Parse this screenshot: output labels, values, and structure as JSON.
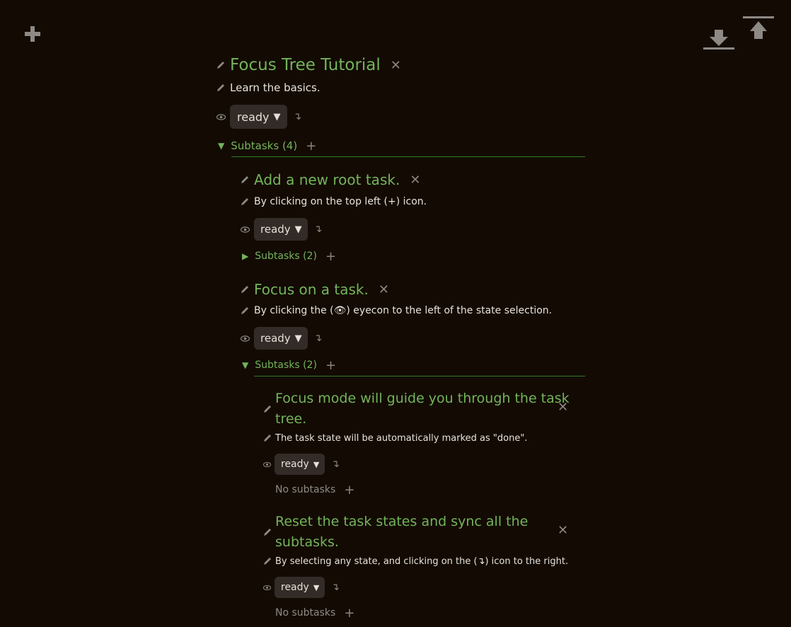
{
  "toolbar": {
    "add_root_icon": "plus-icon",
    "download_icon": "download-icon",
    "upload_icon": "upload-icon"
  },
  "root": {
    "title": "Focus Tree Tutorial",
    "description": "Learn the basics.",
    "state": "ready",
    "subtasks_label": "Subtasks (4)"
  },
  "tasks": [
    {
      "title": "Add a new root task.",
      "description": "By clicking on the top left (+) icon.",
      "state": "ready",
      "subtasks_label": "Subtasks (2)"
    },
    {
      "title": "Focus on a task.",
      "description": "By clicking the (👁) eyecon to the left of the state selection.",
      "state": "ready",
      "subtasks_label": "Subtasks (2)",
      "children": [
        {
          "title_line1": "Focus mode will guide you through the task",
          "title_line2": "tree.",
          "description": "The task state will be automatically marked as \"done\".",
          "state": "ready",
          "subtasks_label": "No subtasks"
        },
        {
          "title_line1": "Reset the task states and sync all the",
          "title_line2": "subtasks.",
          "description": "By selecting any state, and clicking on the (↴) icon to the right.",
          "state": "ready",
          "subtasks_label": "No subtasks"
        }
      ]
    }
  ],
  "colors": {
    "background": "#130b03",
    "accent_green": "#74b35c",
    "rule_green": "#2b7a22",
    "select_bg": "#322b27",
    "icon_gray": "#8d8985"
  }
}
